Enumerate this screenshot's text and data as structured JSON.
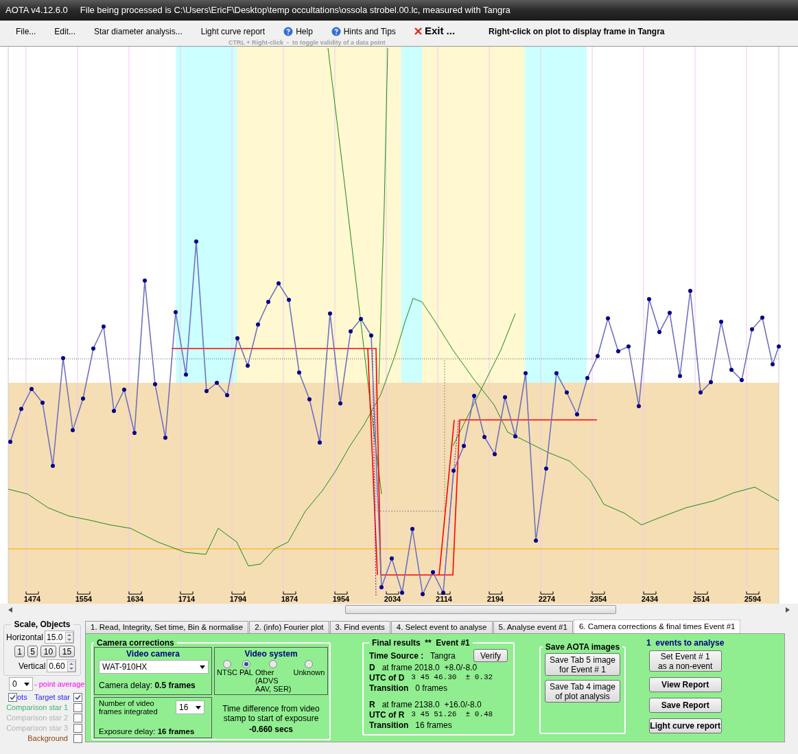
{
  "window": {
    "app": "AOTA v4.12.6.0",
    "file": "File being processed is C:\\Users\\EricF\\Desktop\\temp occultations\\ossola strobel.00.lc, measured with Tangra"
  },
  "menu": [
    {
      "label": "File...",
      "kind": "plain"
    },
    {
      "label": "Edit...",
      "kind": "plain"
    },
    {
      "label": "Star diameter analysis...",
      "kind": "plain"
    },
    {
      "label": "Light curve report",
      "kind": "plain"
    },
    {
      "label": "Help",
      "kind": "help"
    },
    {
      "label": "Hints and Tips",
      "kind": "help"
    },
    {
      "label": "Exit ...",
      "kind": "exit"
    }
  ],
  "menu_hint": "CTRL + Right-click  -  to toggle validity of a data point",
  "plot_hint": "Right-click on plot to display frame in Tangra",
  "plot": {
    "x_tick_labels": [
      "1474",
      "1554",
      "1634",
      "1714",
      "1794",
      "1874",
      "1954",
      "2034",
      "2114",
      "2194",
      "2274",
      "2354",
      "2434",
      "2514",
      "2594"
    ]
  },
  "scale_panel": {
    "title": "Scale,  Objects",
    "horizontal_label": "Horizontal",
    "horizontal_value": "15.0",
    "scale_buttons": [
      "1",
      "5",
      "10",
      "15"
    ],
    "vertical_label": "Vertical",
    "vertical_value": "0.60",
    "average_value": "0",
    "average_label": "- point average"
  },
  "plots_toggle": {
    "label": "ots",
    "checked": true
  },
  "objects": [
    {
      "label": "Target star",
      "checked": true,
      "color": "#1e1eff"
    },
    {
      "label": "Comparison star 1",
      "checked": false,
      "color": "#3cb371"
    },
    {
      "label": "Comparison star 2",
      "checked": false,
      "color": "#b4b4b4"
    },
    {
      "label": "Comparison star 3",
      "checked": false,
      "color": "#b4b4b4"
    },
    {
      "label": "Background",
      "checked": false,
      "color": "#8b4513"
    }
  ],
  "tabs": [
    {
      "label": "1.  Read, Integrity, Set time, Bin & normalise",
      "selected": false
    },
    {
      "label": "2. (info)  Fourier plot",
      "selected": false
    },
    {
      "label": "3. Find events",
      "selected": false
    },
    {
      "label": "4. Select event to analyse",
      "selected": false
    },
    {
      "label": "5. Analyse event #1",
      "selected": false
    },
    {
      "label": "6. Camera corrections & final times Event #1",
      "selected": true
    }
  ],
  "camera_corrections": {
    "title": "Camera corrections",
    "video_camera": {
      "title": "Video camera",
      "value": "WAT-910HX",
      "delay_label": "Camera delay:",
      "delay_value": "0.5 frames"
    },
    "video_system": {
      "title": "Video system",
      "options": [
        {
          "label": "NTSC",
          "selected": false
        },
        {
          "label": "PAL",
          "selected": true
        },
        {
          "label": "Other\n(ADVS\nAAV, SER)",
          "selected": false
        },
        {
          "label": "Unknown",
          "selected": false
        }
      ]
    },
    "integration": {
      "label": "Number of video frames integrated",
      "value": "16",
      "delay_label": "Exposure delay:",
      "delay_value": "16 frames"
    },
    "time_difference": {
      "label": "Time difference from video stamp to start of exposure",
      "value": "-0.660 secs"
    }
  },
  "final_results": {
    "title": "Final results",
    "marker": "**",
    "event": "Event #1",
    "verify": "Verify",
    "time_source_label": "Time Source :",
    "time_source": "Tangra",
    "events": [
      {
        "rows": [
          {
            "label": "D",
            "value": "at frame 2018.0  +8.0/-8.0",
            "kind": "text"
          },
          {
            "label": "UTC of D",
            "value": "3 45 46.30  ± 0.32",
            "kind": "time"
          },
          {
            "label": "Transition",
            "value": "0 frames",
            "kind": "text"
          }
        ]
      },
      {
        "rows": [
          {
            "label": "R",
            "value": "at frame 2138.0  +16.0/-8.0",
            "kind": "text"
          },
          {
            "label": "UTC of R",
            "value": "3 45 51.26  ± 0.48",
            "kind": "time"
          },
          {
            "label": "Transition",
            "value": "16 frames",
            "kind": "text"
          }
        ]
      }
    ]
  },
  "save_images": {
    "title": "Save AOTA images",
    "buttons": [
      "Save Tab 5 image\nfor Event # 1",
      "Save Tab 4 image\nof plot analysis"
    ]
  },
  "actions": {
    "title": "1  events to analyse",
    "buttons": [
      {
        "label": "Set Event # 1\nas a non-event",
        "kind": "plain"
      },
      {
        "label": "View Report",
        "kind": "bold"
      },
      {
        "label": "Save Report",
        "kind": "bold"
      },
      {
        "label": "Light curve report",
        "kind": "bold"
      }
    ]
  }
}
